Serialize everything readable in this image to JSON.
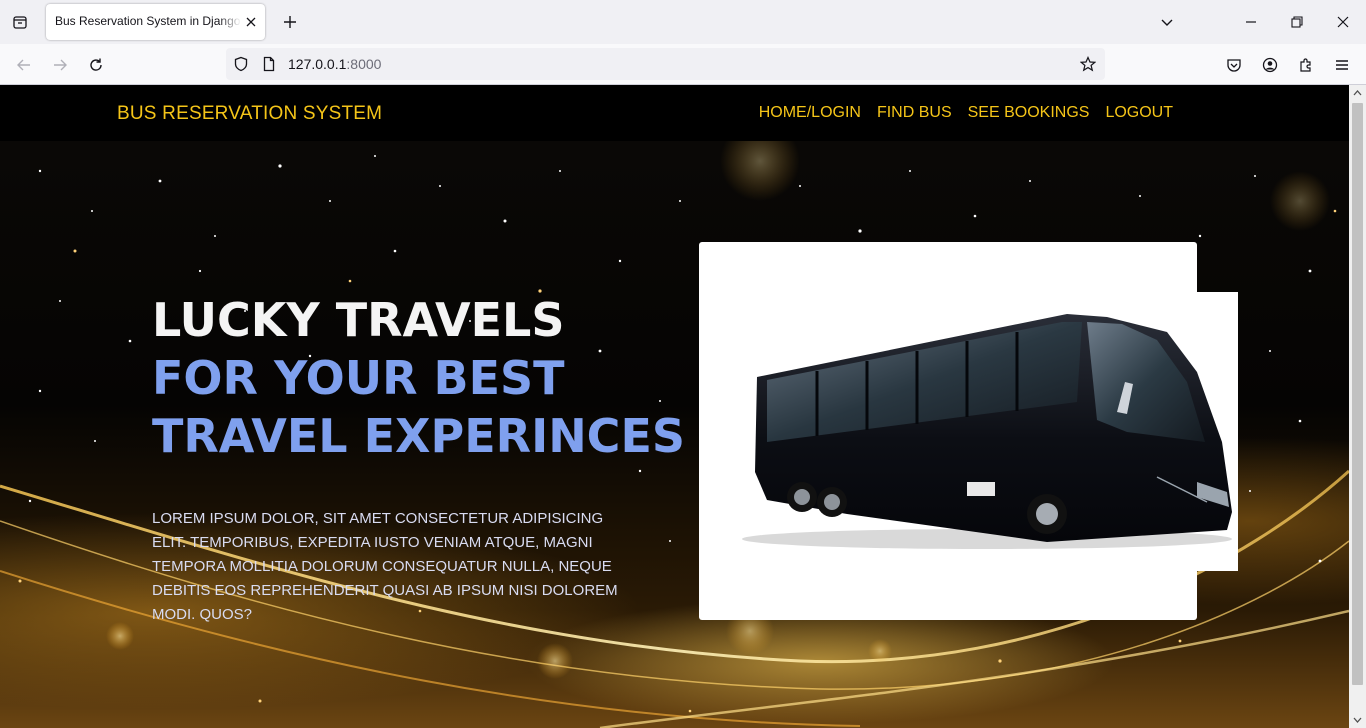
{
  "browser": {
    "tab_title": "Bus Reservation System in Django Framework",
    "url_host": "127.0.0.1",
    "url_port": ":8000"
  },
  "site": {
    "brand": "BUS RESERVATION SYSTEM",
    "menu": [
      "HOME/LOGIN",
      "FIND BUS",
      "SEE BOOKINGS",
      "LOGOUT"
    ]
  },
  "hero": {
    "title_line1": "LUCKY TRAVELS",
    "title_line2": "FOR YOUR BEST",
    "title_line3": "TRAVEL EXPERINCES",
    "description": "Lorem ipsum dolor, sit amet consectetur adipisicing elit. Temporibus, expedita iusto veniam atque, magni tempora mollitia dolorum consequatur nulla, neque debitis eos reprehenderit quasi ab ipsum nisi dolorem modi. Quos?",
    "image_icon": "bus-photo"
  },
  "colors": {
    "brand": "#f5c518",
    "title_white": "#f4f4f4",
    "title_blue": "#7fa0ee"
  }
}
